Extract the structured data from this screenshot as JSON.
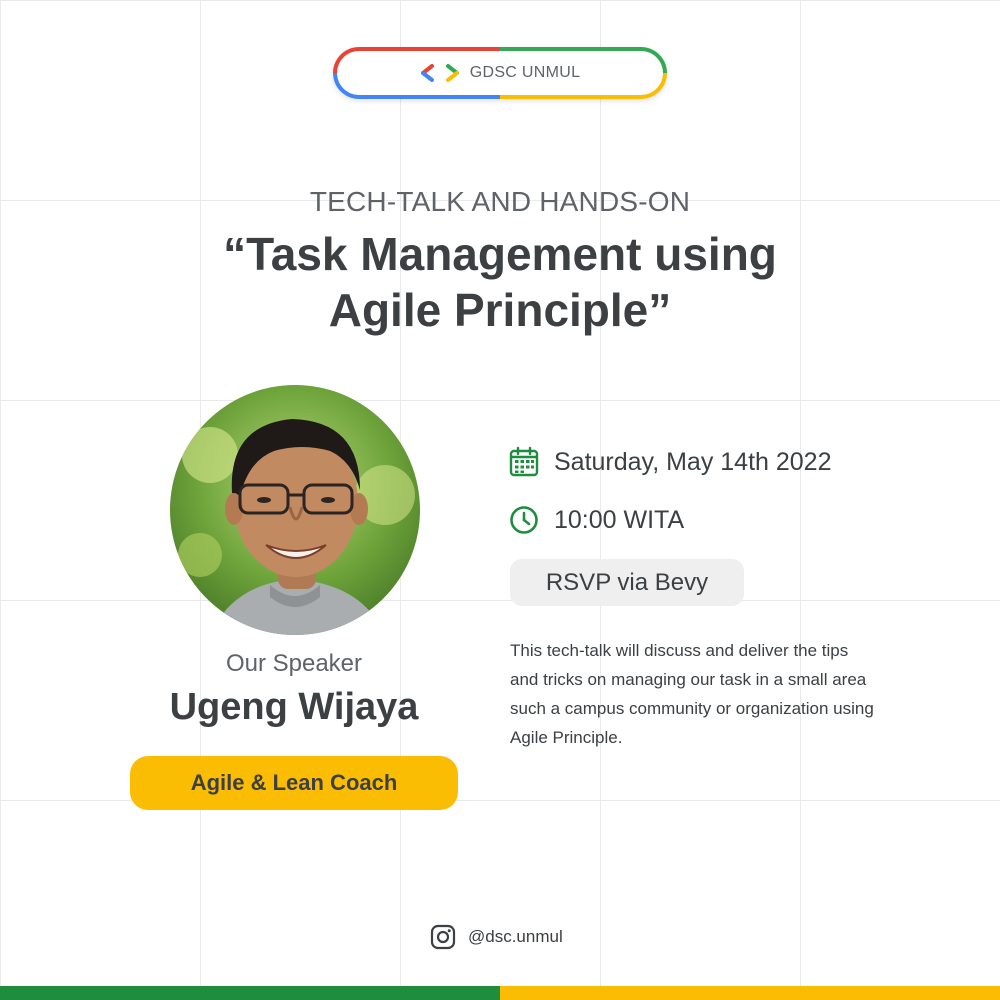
{
  "header": {
    "brand_text": "GDSC UNMUL",
    "logo_icon": "gdsc-brackets-icon",
    "ring_colors": {
      "top_left": "#ea4335",
      "top_right": "#34a853",
      "bottom_right": "#fbbc04",
      "bottom_left": "#4285f4"
    }
  },
  "event": {
    "subtitle": "TECH-TALK AND HANDS-ON",
    "title_line1": "“Task Management using",
    "title_line2": "Agile Principle”"
  },
  "speaker": {
    "label": "Our Speaker",
    "name": "Ugeng Wijaya",
    "role": "Agile & Lean Coach"
  },
  "details": {
    "date_icon": "calendar-icon",
    "date": "Saturday, May 14th 2022",
    "time_icon": "clock-icon",
    "time": "10:00 WITA",
    "rsvp_label": "RSVP via Bevy",
    "description": "This tech-talk will discuss and deliver the tips and tricks on managing our task in a small area such a campus community or organization using Agile Principle."
  },
  "footer": {
    "social_icon": "instagram-icon",
    "handle": "@dsc.unmul",
    "bar_colors": [
      "#1e8e3e",
      "#fbbc04"
    ]
  },
  "colors": {
    "accent_green": "#1e8e3e",
    "accent_yellow": "#fbbc04",
    "text_dark": "#3c4043",
    "text_muted": "#5f6368"
  }
}
